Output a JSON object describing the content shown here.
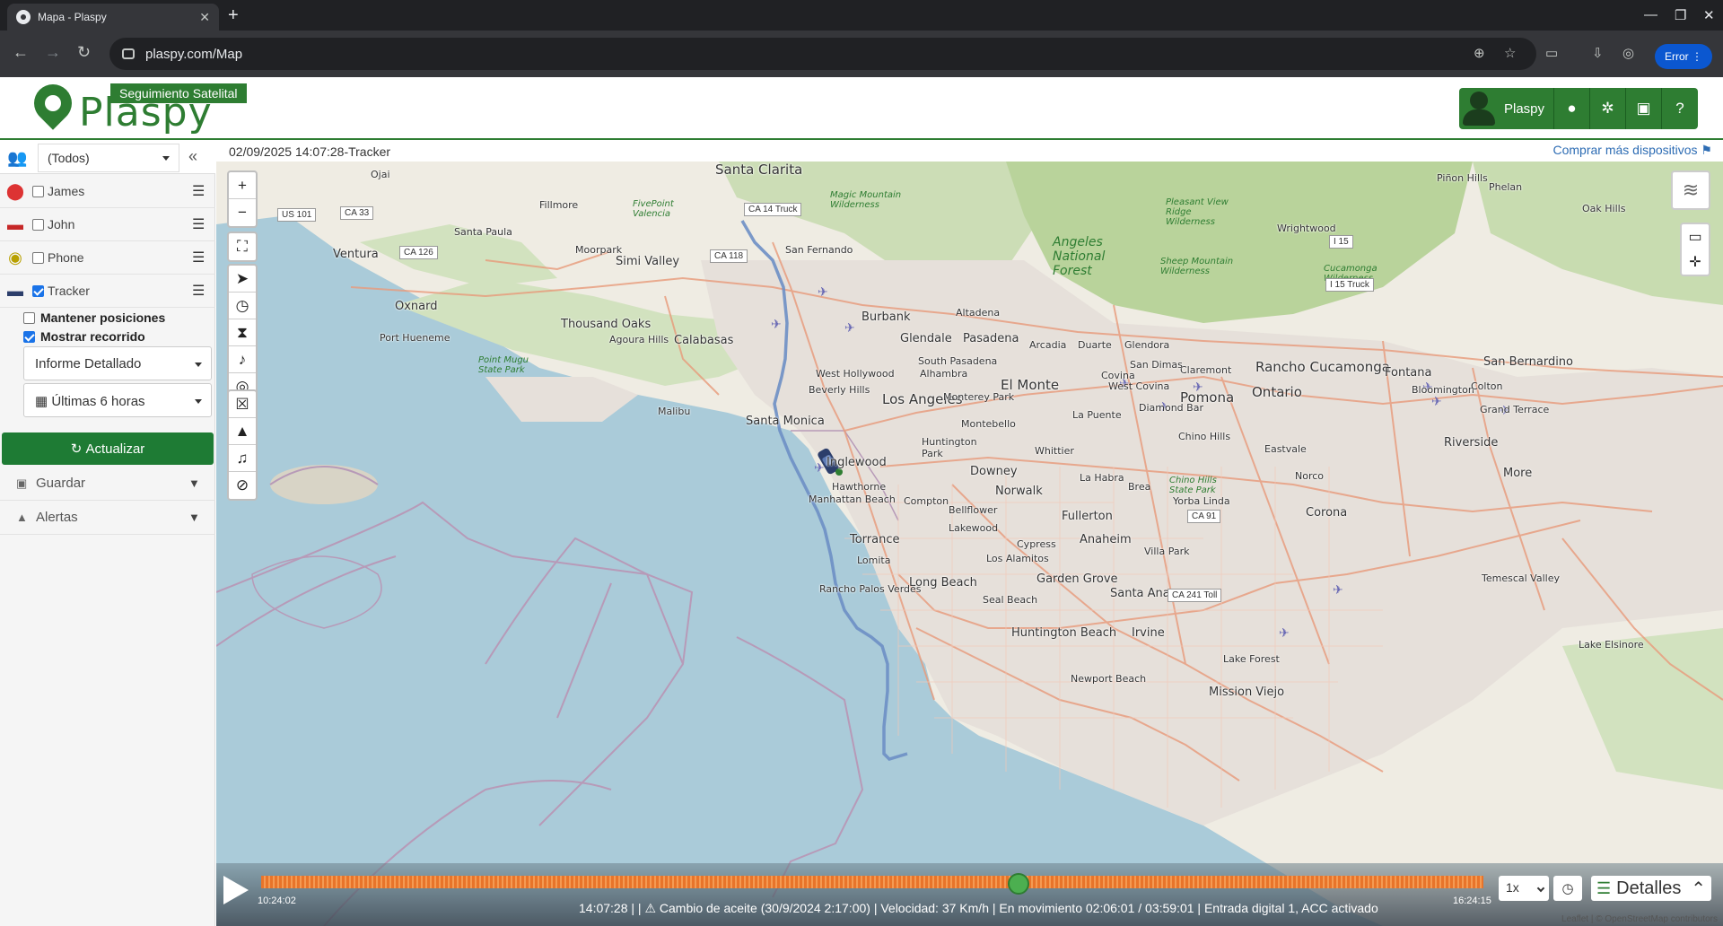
{
  "browser": {
    "tab_title": "Mapa - Plaspy",
    "url": "plaspy.com/Map",
    "profile_label": "Error"
  },
  "header": {
    "logo_text": "Plaspy",
    "logo_badge": "Seguimiento Satelital",
    "user_label": "Plaspy"
  },
  "sidebar": {
    "group_select": "(Todos)",
    "devices": [
      {
        "name": "James",
        "checked": false,
        "icon": "person-pin-icon"
      },
      {
        "name": "John",
        "checked": false,
        "icon": "truck-icon"
      },
      {
        "name": "Phone",
        "checked": false,
        "icon": "phone-pin-icon"
      },
      {
        "name": "Tracker",
        "checked": true,
        "icon": "car-icon"
      }
    ],
    "keep_positions_label": "Mantener posiciones",
    "show_route_label": "Mostrar recorrido",
    "report_select": "Informe Detallado",
    "range_select": "Últimas 6 horas",
    "refresh_label": "Actualizar",
    "save_label": "Guardar",
    "alerts_label": "Alertas"
  },
  "map": {
    "timestamp_title": "02/09/2025 14:07:28-Tracker",
    "buy_more_label": "Comprar más dispositivos",
    "labels": {
      "santa_clarita": "Santa Clarita",
      "ojai": "Ojai",
      "fillmore": "Fillmore",
      "santa_paula": "Santa Paula",
      "ventura": "Ventura",
      "oxnard": "Oxnard",
      "port_hueneme": "Port Hueneme",
      "moorpark": "Moorpark",
      "simi_valley": "Simi Valley",
      "thousand_oaks": "Thousand Oaks",
      "agoura_hills": "Agoura Hills",
      "calabasas": "Calabasas",
      "san_fernando": "San Fernando",
      "burbank": "Burbank",
      "glendale": "Glendale",
      "pasadena": "Pasadena",
      "altadena": "Altadena",
      "arcadia": "Arcadia",
      "duarte": "Duarte",
      "glendora": "Glendora",
      "west_hollywood": "West Hollywood",
      "beverly_hills": "Beverly Hills",
      "los_angeles": "Los Angeles",
      "santa_monica": "Santa Monica",
      "malibu": "Malibu",
      "inglewood": "Inglewood",
      "hawthorne": "Hawthorne",
      "manhattan_beach": "Manhattan Beach",
      "torrance": "Torrance",
      "lomita": "Lomita",
      "long_beach": "Long Beach",
      "rancho_palos_verdes": "Rancho Palos Verdes",
      "downey": "Downey",
      "norwalk": "Norwalk",
      "compton": "Compton",
      "el_monte": "El Monte",
      "monterey_park": "Monterey Park",
      "montebello": "Montebello",
      "whittier": "Whittier",
      "la_habra": "La Habra",
      "brea": "Brea",
      "fullerton": "Fullerton",
      "anaheim": "Anaheim",
      "garden_grove": "Garden Grove",
      "santa_ana": "Santa Ana",
      "irvine": "Irvine",
      "huntington_beach": "Huntington Beach",
      "newport_beach": "Newport Beach",
      "mission_viejo": "Mission Viejo",
      "lake_forest": "Lake Forest",
      "cypress": "Cypress",
      "los_alamitos": "Los Alamitos",
      "seal_beach": "Seal Beach",
      "lakewood": "Lakewood",
      "bellflower": "Bellflower",
      "la_puente": "La Puente",
      "pomona": "Pomona",
      "ontario": "Ontario",
      "chino_hills": "Chino Hills",
      "rancho_cucamonga": "Rancho Cucamonga",
      "fontana": "Fontana",
      "san_bernardino": "San Bernardino",
      "riverside": "Riverside",
      "corona": "Corona",
      "norco": "Norco",
      "eastvale": "Eastvale",
      "claremont": "Claremont",
      "san_dimas": "San Dimas",
      "covina": "Covina",
      "diamond_bar": "Diamond Bar",
      "yorba_linda": "Yorba Linda",
      "villa_park": "Villa Park",
      "temescal_valley": "Temescal Valley",
      "lake_elsinore": "Lake Elsinore",
      "phelan": "Phelan",
      "pinon_hills": "Piñon Hills",
      "wrightwood": "Wrightwood",
      "oak_hills": "Oak Hills",
      "angeles_nf": "Angeles National Forest",
      "magic_mountain": "Magic Mountain Wilderness",
      "pleasant_view": "Pleasant View Ridge Wilderness",
      "sheep_mountain": "Sheep Mountain Wilderness",
      "cucamonga_wilderness": "Cucamonga Wilderness",
      "fivepoint": "FivePoint Valencia",
      "point_mugu": "Point Mugu State Park",
      "chino_hills_sp": "Chino Hills State Park",
      "huntington_park": "Huntington Park",
      "south_pasadena": "South Pasadena",
      "alhambra": "Alhambra",
      "west_covina": "West Covina",
      "bloomington": "Bloomington",
      "colton": "Colton",
      "grand_terrace": "Grand Terrace",
      "more": "More"
    },
    "shields": {
      "us101": "US 101",
      "ca33": "CA 33",
      "ca126": "CA 126",
      "ca118": "CA 118",
      "ca14": "CA 14 Truck",
      "i15": "I 15",
      "i15truck": "I 15 Truck",
      "ca91": "CA 91",
      "ca241": "CA 241 Toll"
    }
  },
  "playback": {
    "start_time": "10:24:02",
    "end_time": "16:24:15",
    "progress": 0.62,
    "info": "14:07:28 | | ⚠ Cambio de aceite (30/9/2024 2:17:00) | Velocidad: 37 Km/h | En movimiento 02:06:01 / 03:59:01 | Entrada digital 1, ACC activado",
    "speed": "1x",
    "details_label": "Detalles",
    "attribution": "Leaflet | © OpenStreetMap contributors"
  }
}
